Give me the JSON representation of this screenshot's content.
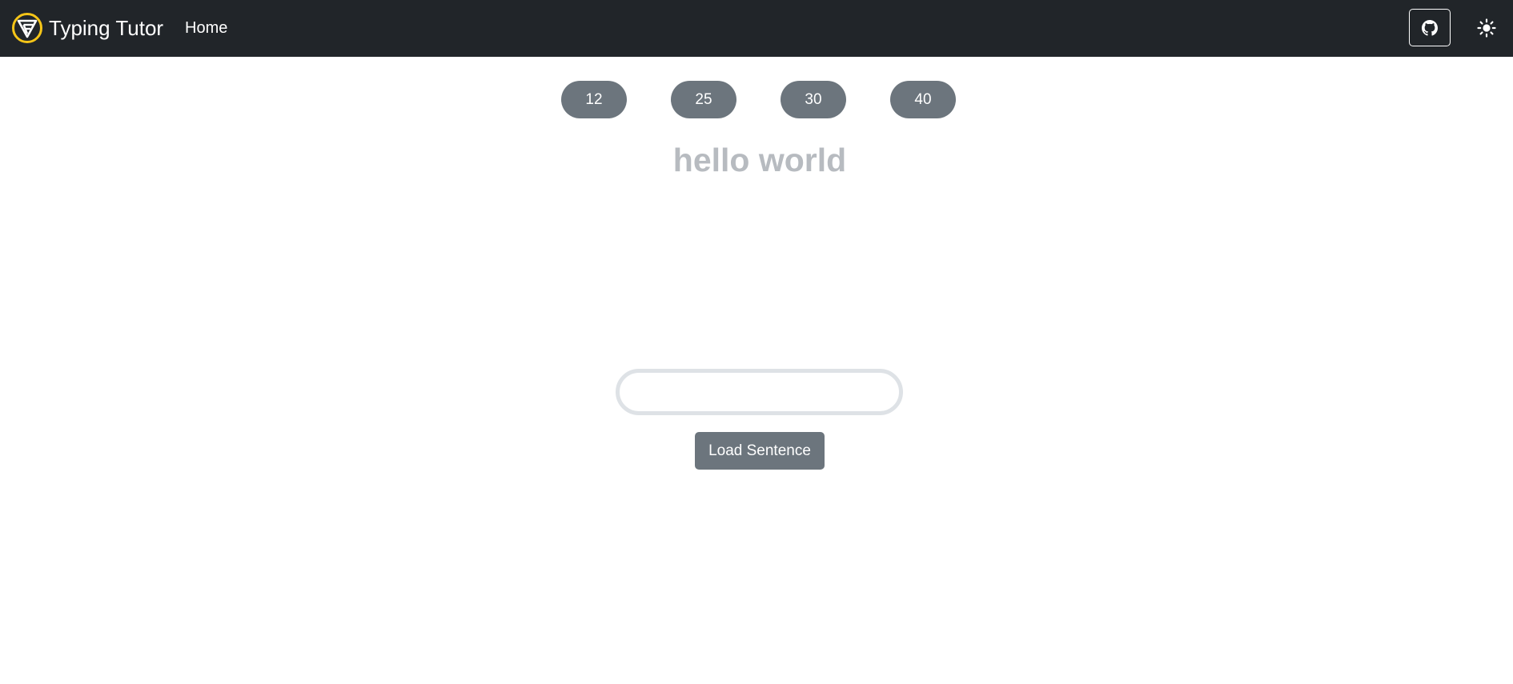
{
  "navbar": {
    "brand_text": "Typing Tutor",
    "home_label": "Home",
    "github_icon": "github-icon",
    "theme_icon": "sun-icon",
    "logo_icon": "typing-tutor-logo",
    "colors": {
      "background": "#212529",
      "text": "#ffffff",
      "logo_accent": "#f5c518"
    }
  },
  "counts": {
    "items": [
      {
        "label": "12"
      },
      {
        "label": "25"
      },
      {
        "label": "30"
      },
      {
        "label": "40"
      }
    ],
    "color": "#6c757d"
  },
  "sentence": {
    "text": "hello world",
    "color": "#b7bbc0"
  },
  "input": {
    "value": "",
    "placeholder": "",
    "border_color": "#dee2e6"
  },
  "load_button": {
    "label": "Load Sentence",
    "color": "#6c757d"
  }
}
